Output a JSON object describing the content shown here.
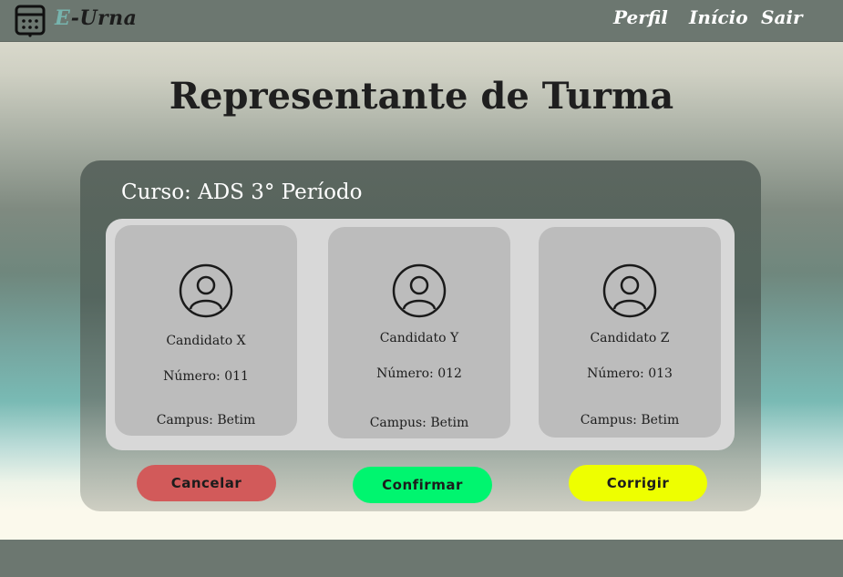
{
  "header": {
    "brand_prefix": "E",
    "brand_suffix": "-Urna",
    "logo_icon": "ballot-box-icon",
    "nav": [
      {
        "label": "Perfil"
      },
      {
        "label": "Início"
      },
      {
        "label": "Sair"
      }
    ]
  },
  "page": {
    "title": "Representante de Turma"
  },
  "panel": {
    "course_label": "Curso: ADS 3° Período"
  },
  "candidates": [
    {
      "name": "Candidato X",
      "number": "Número: 011",
      "campus": "Campus: Betim",
      "icon": "user-avatar-icon"
    },
    {
      "name": "Candidato Y",
      "number": "Número: 012",
      "campus": "Campus: Betim",
      "icon": "user-avatar-icon"
    },
    {
      "name": "Candidato Z",
      "number": "Número: 013",
      "campus": "Campus: Betim",
      "icon": "user-avatar-icon"
    }
  ],
  "actions": {
    "cancel_label": "Cancelar",
    "confirm_label": "Confirmar",
    "correct_label": "Corrigir",
    "colors": {
      "cancel": "#d25a5a",
      "confirm": "#00f56f",
      "correct": "#eeff00"
    }
  },
  "colors": {
    "topbar": "#6c7770",
    "accent": "#77b4ae"
  }
}
